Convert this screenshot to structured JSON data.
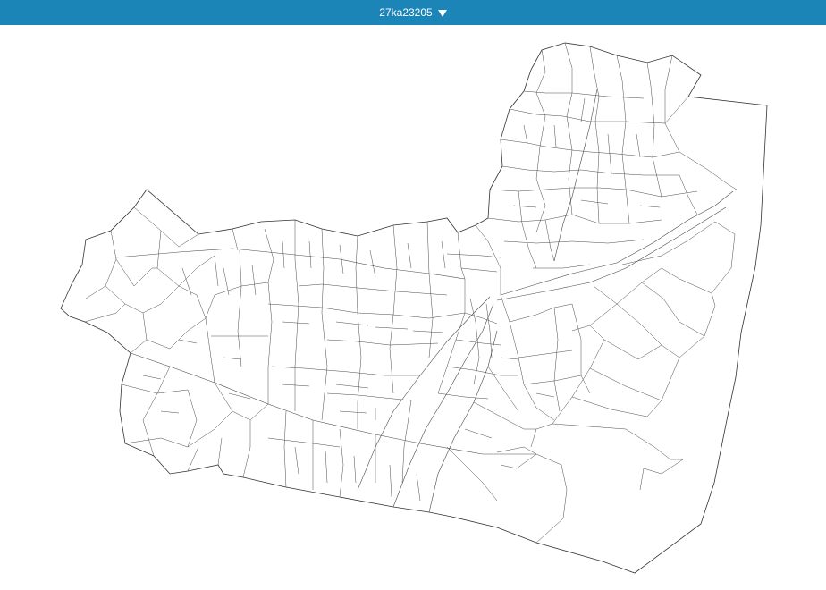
{
  "header": {
    "title": "27ka23205",
    "dropdown_icon": "caret-down-icon",
    "background_color": "#1b85b8",
    "text_color": "#ffffff"
  },
  "map": {
    "region_code": "27ka23205",
    "line_color": "#4a4a4a",
    "fill_color": "#ffffff"
  }
}
